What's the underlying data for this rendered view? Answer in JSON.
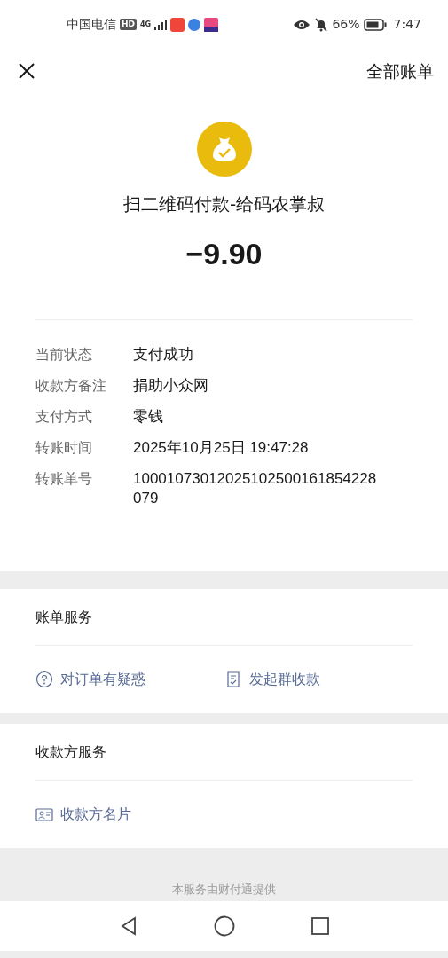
{
  "status_bar": {
    "carrier": "中国电信",
    "hd": "HD",
    "network": "4G",
    "battery": "66%",
    "time": "7:47"
  },
  "header": {
    "title": "全部账单"
  },
  "payment": {
    "title": "扫二维码付款-给码农掌叔",
    "amount": "−9.90"
  },
  "details": [
    {
      "label": "当前状态",
      "value": "支付成功"
    },
    {
      "label": "收款方备注",
      "value": "捐助小众网"
    },
    {
      "label": "支付方式",
      "value": "零钱"
    },
    {
      "label": "转账时间",
      "value": "2025年10月25日 19:47:28"
    },
    {
      "label": "转账单号",
      "value": "10001073012025102500161854228079"
    }
  ],
  "bill_services": {
    "title": "账单服务",
    "actions": [
      {
        "kind": "question",
        "label": "对订单有疑惑"
      },
      {
        "kind": "group",
        "label": "发起群收款"
      }
    ]
  },
  "payee_services": {
    "title": "收款方服务",
    "actions": [
      {
        "kind": "card",
        "label": "收款方名片"
      }
    ]
  },
  "footer": "本服务由财付通提供"
}
